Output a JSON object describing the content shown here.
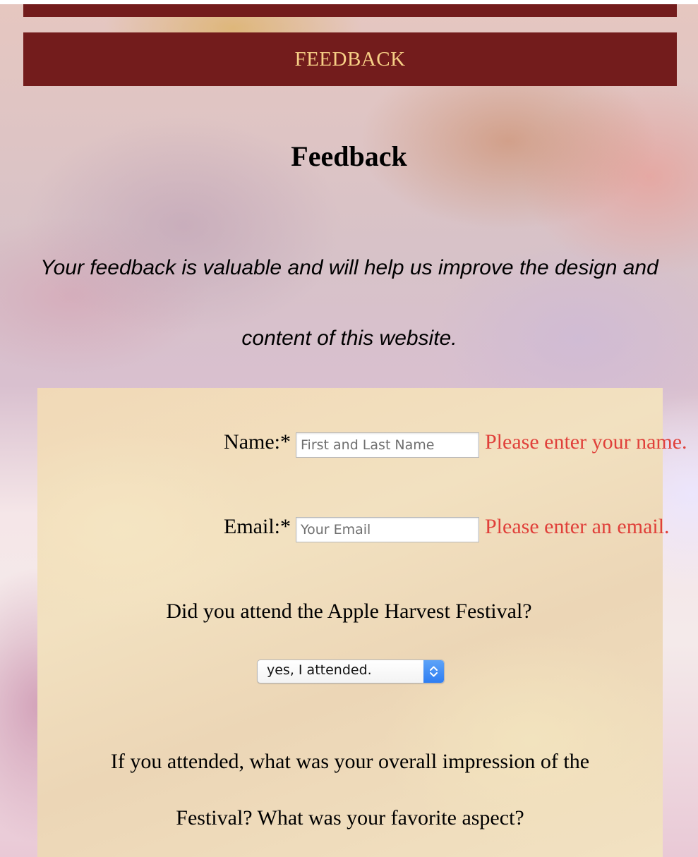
{
  "nav": {
    "label": "FEEDBACK"
  },
  "page": {
    "title": "Feedback",
    "intro": "Your feedback is valuable and will help us improve the design and content of this website."
  },
  "form": {
    "name": {
      "label": "Name:*",
      "placeholder": "First and Last Name",
      "error": "Please enter your name."
    },
    "email": {
      "label": "Email:*",
      "placeholder": "Your Email",
      "error": "Please enter an email."
    },
    "attended": {
      "question": "Did you attend the Apple Harvest Festival?",
      "selected": "yes, I attended."
    },
    "impression": {
      "question": "If you attended, what was your overall impression of the Festival? What was your favorite aspect?"
    }
  },
  "colors": {
    "nav_bg": "#731c1c",
    "nav_text": "#f7cf86",
    "error": "#e0403a",
    "panel_bg": "#f1dcb9",
    "select_accent": "#3b8af5"
  },
  "icons": {
    "select": "chevron-up-down-icon"
  }
}
